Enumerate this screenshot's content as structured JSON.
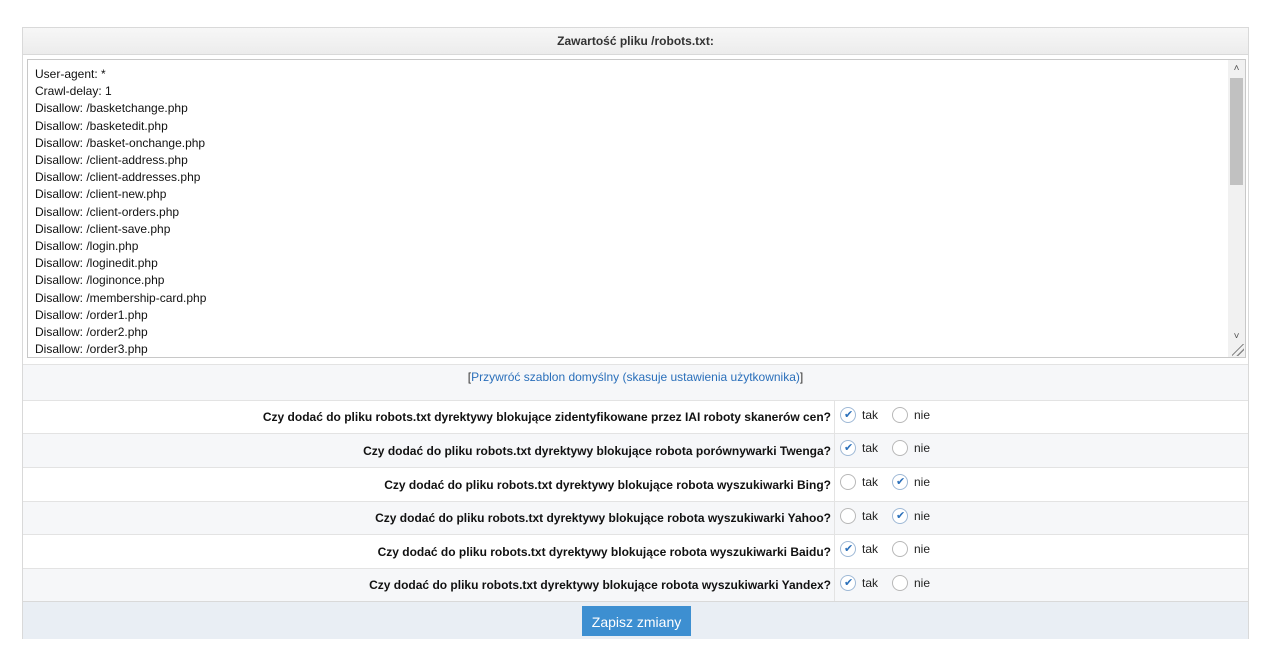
{
  "header": {
    "title": "Zawartość pliku /robots.txt:"
  },
  "editor": {
    "lines": [
      "User-agent: *",
      "Crawl-delay: 1",
      "Disallow: /basketchange.php",
      "Disallow: /basketedit.php",
      "Disallow: /basket-onchange.php",
      "Disallow: /client-address.php",
      "Disallow: /client-addresses.php",
      "Disallow: /client-new.php",
      "Disallow: /client-orders.php",
      "Disallow: /client-save.php",
      "Disallow: /login.php",
      "Disallow: /loginedit.php",
      "Disallow: /loginonce.php",
      "Disallow: /membership-card.php",
      "Disallow: /order1.php",
      "Disallow: /order2.php",
      "Disallow: /order3.php"
    ]
  },
  "restore": {
    "bracket_open": "[",
    "link_text": "Przywróć szablon domyślny (skasuje ustawienia użytkownika)",
    "bracket_close": "]"
  },
  "options": [
    {
      "question": "Czy dodać do pliku robots.txt dyrektywy blokujące zidentyfikowane przez IAI roboty skanerów cen?",
      "selected": "tak"
    },
    {
      "question": "Czy dodać do pliku robots.txt dyrektywy blokujące robota porównywarki Twenga?",
      "selected": "tak"
    },
    {
      "question": "Czy dodać do pliku robots.txt dyrektywy blokujące robota wyszukiwarki Bing?",
      "selected": "nie"
    },
    {
      "question": "Czy dodać do pliku robots.txt dyrektywy blokujące robota wyszukiwarki Yahoo?",
      "selected": "nie"
    },
    {
      "question": "Czy dodać do pliku robots.txt dyrektywy blokujące robota wyszukiwarki Baidu?",
      "selected": "tak"
    },
    {
      "question": "Czy dodać do pliku robots.txt dyrektywy blokujące robota wyszukiwarki Yandex?",
      "selected": "tak"
    }
  ],
  "radio_labels": {
    "yes": "tak",
    "no": "nie"
  },
  "save": {
    "label": "Zapisz zmiany"
  },
  "colors": {
    "accent": "#3d8fd1",
    "link": "#2a6fba",
    "check": "#2a6fba"
  }
}
